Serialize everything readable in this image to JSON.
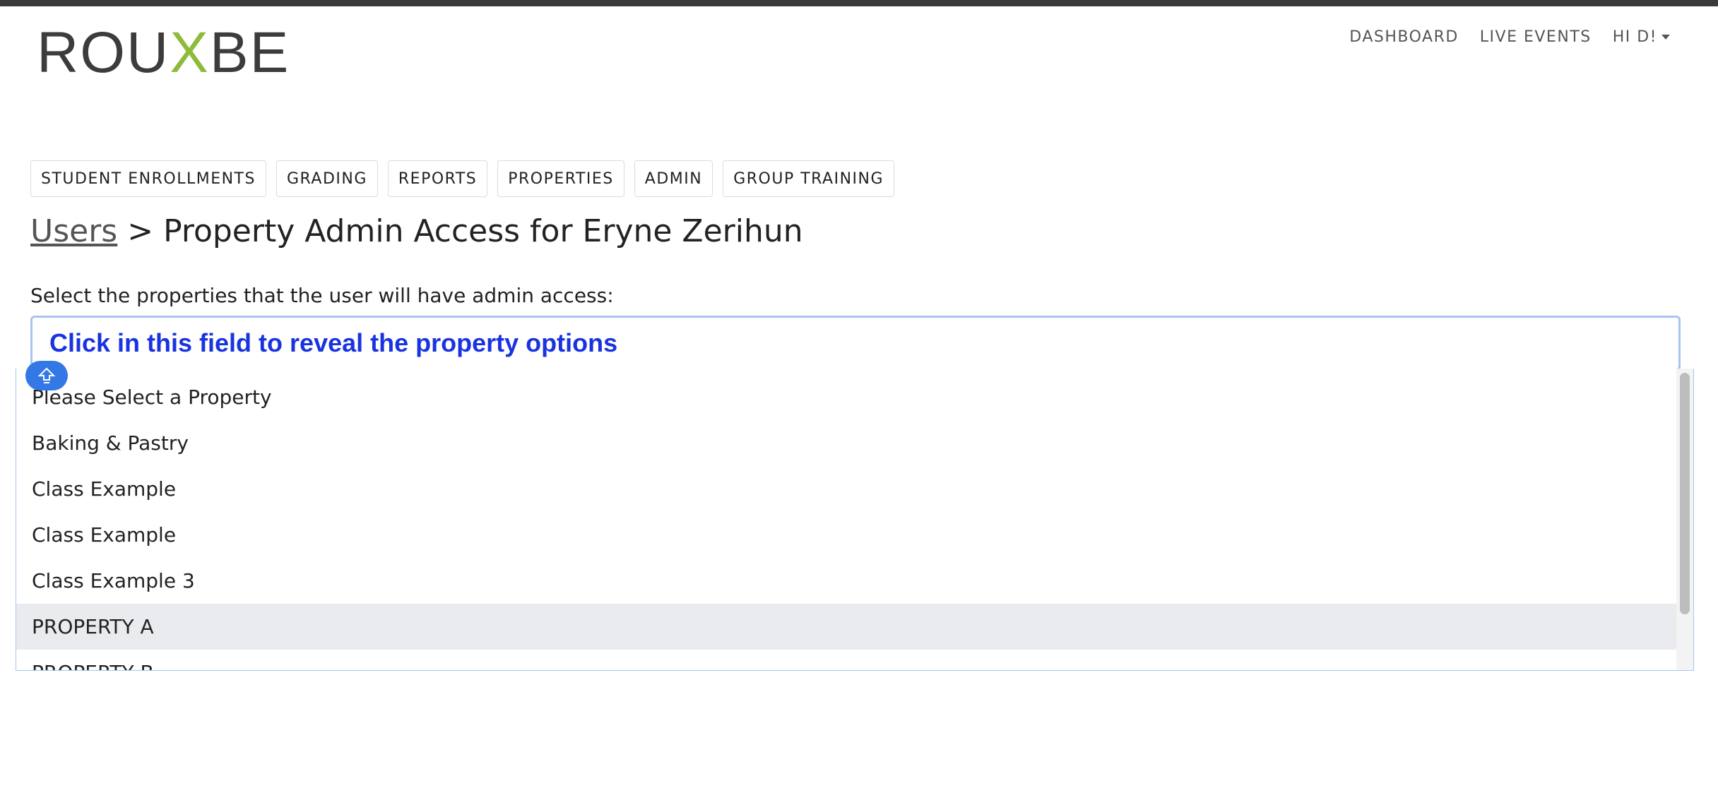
{
  "logo": {
    "part1": "ROU",
    "part2": "X",
    "part3": "BE"
  },
  "nav": {
    "dashboard": "DASHBOARD",
    "live_events": "LIVE EVENTS",
    "user_menu": "HI D!"
  },
  "tabs": [
    {
      "label": "STUDENT ENROLLMENTS"
    },
    {
      "label": "GRADING"
    },
    {
      "label": "REPORTS"
    },
    {
      "label": "PROPERTIES"
    },
    {
      "label": "ADMIN"
    },
    {
      "label": "GROUP TRAINING"
    }
  ],
  "breadcrumb": {
    "link": "Users",
    "separator": " > ",
    "current": "Property Admin Access for Eryne Zerihun"
  },
  "instruction": "Select the properties that the user will have admin access:",
  "field": {
    "hint": "Click in this field to reveal the property options"
  },
  "options": [
    {
      "label": "Please Select a Property"
    },
    {
      "label": "Baking & Pastry"
    },
    {
      "label": "Class Example"
    },
    {
      "label": "Class Example"
    },
    {
      "label": "Class Example 3"
    },
    {
      "label": "PROPERTY A"
    },
    {
      "label": "PROPERTY B"
    }
  ],
  "colors": {
    "accent": "#8dbb3a",
    "hint_text": "#1a33e0",
    "highlight": "#e9ebef",
    "badge": "#3478e6"
  },
  "icons": {
    "badge": "upload-arrow-icon",
    "user_caret": "caret-down-icon"
  }
}
